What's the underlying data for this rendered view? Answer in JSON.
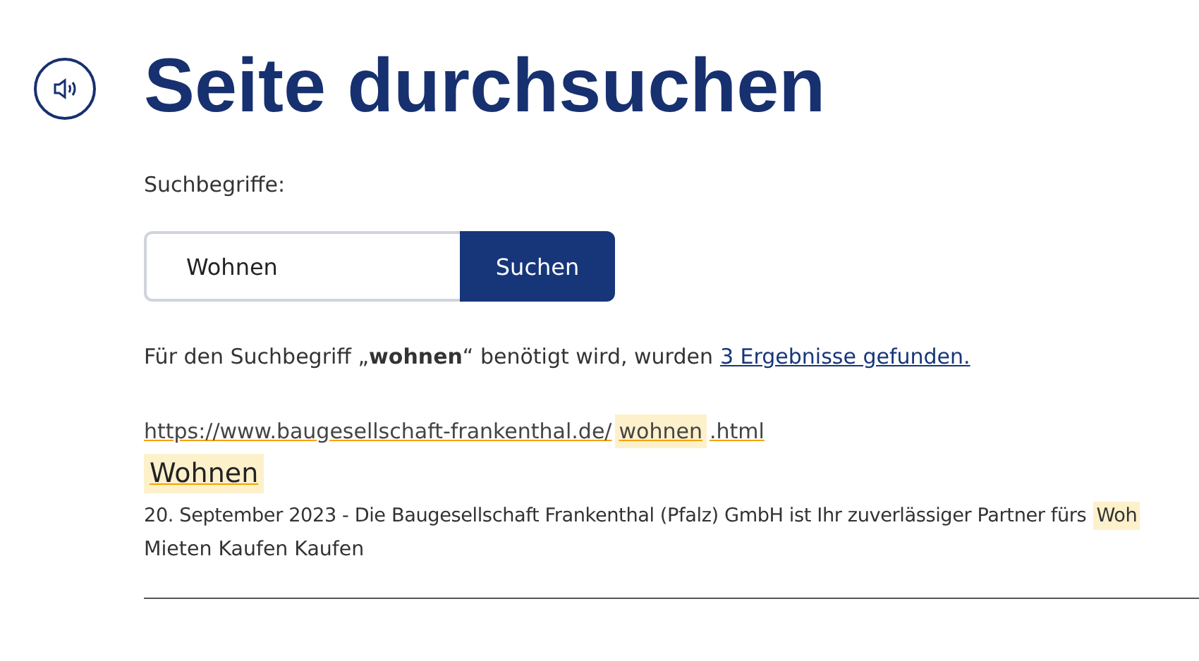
{
  "title": "Seite durchsuchen",
  "search": {
    "label": "Suchbegriffe:",
    "value": "Wohnen",
    "button": "Suchen"
  },
  "summary": {
    "text": "Für den Suchbegriff „**wohnen**“ benötigt wird, wurden",
    "link": "3 Ergebnisse gefunden."
  },
  "results": [
    {
      "url_parts": [
        {
          "text": "https://www.baugesellschaft-frankenthal.de/",
          "highlighted": false
        },
        {
          "text": "wohnen",
          "highlighted": true
        },
        {
          "text": ".html",
          "highlighted": false
        }
      ],
      "title_parts": [
        {
          "text": "Wohnen",
          "highlighted": true
        }
      ],
      "snippet_parts": [
        {
          "text": "20. September 2023 - Die Baugesellschaft Frankenthal (Pfalz) GmbH ist Ihr zuverlässiger Partner fürs",
          "highlighted": false
        },
        {
          "text": "Woh",
          "highlighted": true
        }
      ],
      "snippet_line2": "Mieten Kaufen Kaufen"
    }
  ]
}
